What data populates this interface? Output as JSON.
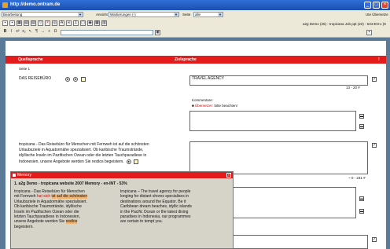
{
  "window": {
    "title": "http://demo.ontram.de"
  },
  "row1": {
    "mode": "Bearbeitung",
    "view_label": "Ansicht",
    "view_value": "Wartierungen (-)",
    "page_label": "Seite",
    "page_value": "alle",
    "right_text": "Ute Übersetze"
  },
  "row2": {
    "status": "a2g Demo (25) - tropicana Job ppt (22) - test-EN-x (8"
  },
  "columns": {
    "source": "Quellsprache",
    "target": "Zielsprache",
    "excl": "!"
  },
  "page_label": "Seite 1",
  "seg1": {
    "source": "DAS REISEBÜRO",
    "target": "TRAVEL AGENCY",
    "meta": "13 - 20 #",
    "comments_label": "Kommentare:",
    "comment_type": "Übersetzer:",
    "comment_text": "bitte beachten!"
  },
  "seg2": {
    "source_lines": [
      "tropicana - Das Reisebüro für Menschen mit Fernweh ist auf die schönsten",
      "Urlaubsziele in Aquatormähe spezialisiert. Ob karibische Traumstrände,",
      "idyllische Inseln im Pazifischen Ozean oder die letzten Tauchparadiese in",
      "Indonesien, unsere Angebote werden Sie restlos begeistern."
    ],
    "meta": "~ 0 - 231 #"
  },
  "memory": {
    "title": "Memory",
    "heading": "1. a2g Demo - tropicana website 2007 Memory - en-INT - 53%",
    "src_lines": [
      "tropicana - Das Reisebüro für Menschen",
      "mit Fernweh ",
      "Urlaubsziele in Aquatormähe spezialisiert.",
      "Ob karibische Traumstrände, idyllische",
      "Inseln im Pazifischen Ozean oder die",
      "letzten Tauchparadiese in Indonesien,",
      "unsere Angebote werden Sie ",
      "begeistern."
    ],
    "src_hl1": "hat sich",
    "src_hl2": "ist",
    "src_hl3": "auf die schönsten",
    "src_hl4": "restlos",
    "tgt_lines": [
      "tropicana – The travel agency for people",
      "longing for distant shores specialises in",
      "destinations around the Equator. Be it",
      "Caribbean dream beaches, idyllic islands",
      "in the Pacific Ocean or the latest diving",
      "paradises in Indonesia, our programmes",
      "are certain to tempt you."
    ]
  }
}
